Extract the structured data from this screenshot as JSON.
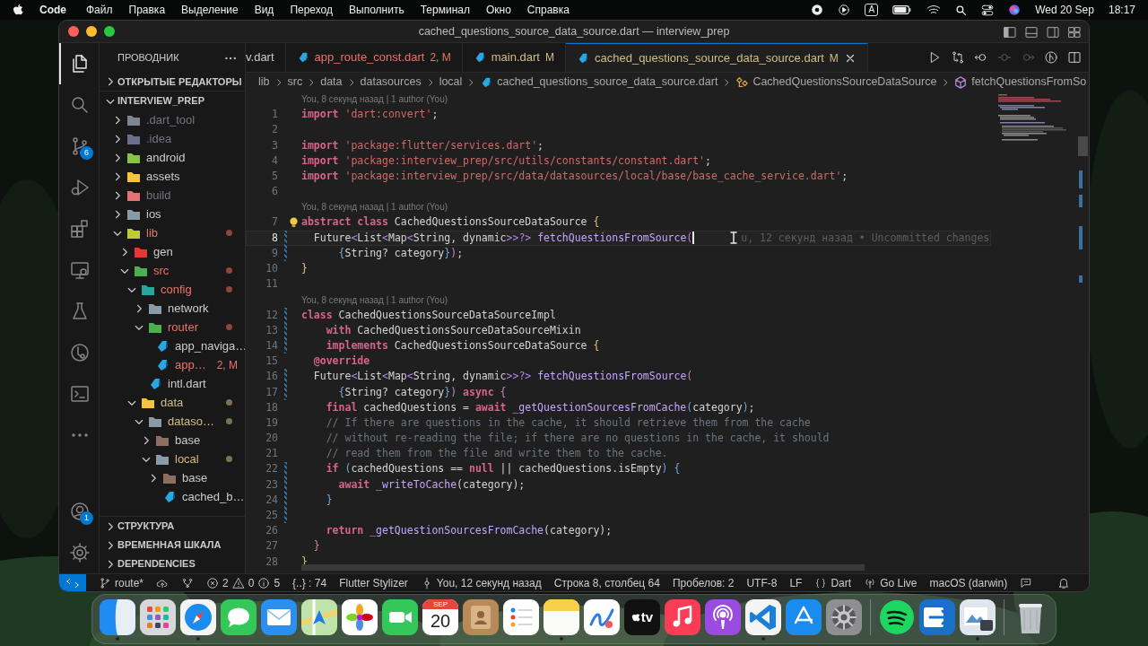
{
  "menu_bar": {
    "app": "Code",
    "items": [
      "Файл",
      "Правка",
      "Выделение",
      "Вид",
      "Переход",
      "Выполнить",
      "Терминал",
      "Окно",
      "Справка"
    ],
    "input_source": "A",
    "date": "Wed 20 Sep",
    "time": "18:17"
  },
  "window": {
    "title": "cached_questions_source_data_source.dart — interview_prep"
  },
  "activity_bar": {
    "top": [
      {
        "kind": "files",
        "selected": true
      },
      {
        "kind": "search",
        "selected": false
      },
      {
        "kind": "scm",
        "selected": false,
        "badge": "6"
      },
      {
        "kind": "debug",
        "selected": false
      },
      {
        "kind": "extensions",
        "selected": false
      },
      {
        "kind": "remote",
        "selected": false
      },
      {
        "kind": "testing",
        "selected": false
      },
      {
        "kind": "timeline",
        "selected": false
      },
      {
        "kind": "terminal",
        "selected": false
      },
      {
        "kind": "more",
        "selected": false
      }
    ],
    "bottom": [
      {
        "kind": "account",
        "selected": false,
        "badge": "1"
      },
      {
        "kind": "settings",
        "selected": false
      }
    ]
  },
  "sidebar": {
    "title": "ПРОВОДНИК",
    "open_editors": {
      "label": "ОТКРЫТЫЕ РЕДАКТОРЫ",
      "expanded": false
    },
    "project": {
      "label": "INTERVIEW_PREP",
      "expanded": true
    },
    "tree": [
      {
        "label": ".dart_tool",
        "kind": "folder",
        "expanded": false,
        "color": "#6e7681",
        "icon": {
          "color": "#7d8590"
        },
        "dot": false
      },
      {
        "label": ".idea",
        "kind": "folder",
        "expanded": false,
        "color": "#6e7681",
        "icon": {
          "color": "#6d6f8a"
        },
        "dot": false
      },
      {
        "label": "android",
        "kind": "folder",
        "expanded": false,
        "color": "#cccccc",
        "icon": {
          "color": "#8bc34a"
        },
        "dot": false
      },
      {
        "label": "assets",
        "kind": "folder",
        "expanded": false,
        "color": "#cccccc",
        "icon": {
          "color": "#f5c242"
        },
        "dot": false
      },
      {
        "label": "build",
        "kind": "folder",
        "expanded": false,
        "color": "#6e7681",
        "icon": {
          "color": "#e57373"
        },
        "dot": false
      },
      {
        "label": "ios",
        "kind": "folder",
        "expanded": false,
        "color": "#cccccc",
        "icon": {
          "color": "#8a9aa6"
        },
        "dot": false
      },
      {
        "label": "lib",
        "kind": "folder",
        "expanded": true,
        "color": "#e8746b",
        "icon": {
          "color": "#c0ca33"
        },
        "dot": true,
        "children": [
          {
            "label": "gen",
            "kind": "folder",
            "expanded": false,
            "color": "#cccccc",
            "icon": {
              "color": "#e53935"
            },
            "dot": false
          },
          {
            "label": "src",
            "kind": "folder",
            "expanded": true,
            "color": "#e8746b",
            "icon": {
              "color": "#4caf50"
            },
            "dot": true,
            "children": [
              {
                "label": "config",
                "kind": "folder",
                "expanded": true,
                "color": "#e8746b",
                "icon": {
                  "color": "#26a69a"
                },
                "dot": true,
                "children": [
                  {
                    "label": "network",
                    "kind": "folder",
                    "expanded": false,
                    "color": "#cccccc",
                    "icon": {
                      "color": "#8a9aa6"
                    },
                    "dot": false
                  },
                  {
                    "label": "router",
                    "kind": "folder",
                    "expanded": true,
                    "color": "#e8746b",
                    "icon": {
                      "color": "#4caf50"
                    },
                    "dot": true,
                    "children": [
                      {
                        "label": "app_naviga…",
                        "kind": "file",
                        "color": "#cccccc",
                        "dot": false
                      },
                      {
                        "label": "app…",
                        "kind": "file",
                        "color": "#e8746b",
                        "badge": "2, M",
                        "dot": false
                      }
                    ]
                  },
                  {
                    "label": "intl.dart",
                    "kind": "file",
                    "color": "#cccccc",
                    "dot": false
                  }
                ]
              },
              {
                "label": "data",
                "kind": "folder",
                "expanded": true,
                "color": "#d2bd84",
                "icon": {
                  "color": "#f5c242"
                },
                "dot": true,
                "children": [
                  {
                    "label": "dataso…",
                    "kind": "folder",
                    "expanded": true,
                    "color": "#d2bd84",
                    "icon": {
                      "color": "#8a9aa6"
                    },
                    "dot": true,
                    "children": [
                      {
                        "label": "base",
                        "kind": "folder",
                        "expanded": false,
                        "color": "#cccccc",
                        "icon": {
                          "color": "#8d6e63"
                        },
                        "dot": false
                      },
                      {
                        "label": "local",
                        "kind": "folder",
                        "expanded": true,
                        "color": "#d2bd84",
                        "icon": {
                          "color": "#8a9aa6"
                        },
                        "dot": true,
                        "children": [
                          {
                            "label": "base",
                            "kind": "folder",
                            "expanded": false,
                            "color": "#cccccc",
                            "icon": {
                              "color": "#8d6e63"
                            },
                            "dot": false
                          },
                          {
                            "label": "cached_b…",
                            "kind": "file",
                            "color": "#cccccc",
                            "dot": false
                          }
                        ]
                      }
                    ]
                  }
                ]
              }
            ]
          }
        ]
      }
    ],
    "bottom_sections": [
      {
        "label": "СТРУКТУРА",
        "expanded": false
      },
      {
        "label": "ВРЕМЕННАЯ ШКАЛА",
        "expanded": false
      },
      {
        "label": "DEPENDENCIES",
        "expanded": false
      }
    ]
  },
  "tabs": [
    {
      "label": "v.dart",
      "color": "#cccccc",
      "icon": false,
      "selected": false
    },
    {
      "label": "app_route_const.dart",
      "badge": "2, M",
      "color": "#e8746b",
      "icon": true,
      "selected": false
    },
    {
      "label": "main.dart",
      "badge": "M",
      "color": "#d2bd84",
      "icon": true,
      "selected": false
    },
    {
      "label": "cached_questions_source_data_source.dart",
      "badge": "M",
      "color": "#d2bd84",
      "icon": true,
      "selected": true
    }
  ],
  "editor_actions": [
    {
      "kind": "run",
      "disabled": false
    },
    {
      "kind": "compare",
      "disabled": false
    },
    {
      "kind": "back",
      "disabled": false
    },
    {
      "kind": "dot",
      "disabled": true
    },
    {
      "kind": "forward",
      "disabled": true
    },
    {
      "kind": "graph",
      "disabled": false
    },
    {
      "kind": "split",
      "disabled": false
    }
  ],
  "breadcrumbs": [
    {
      "label": "lib",
      "kind": "folder"
    },
    {
      "label": "src",
      "kind": "folder"
    },
    {
      "label": "data",
      "kind": "folder"
    },
    {
      "label": "datasources",
      "kind": "folder"
    },
    {
      "label": "local",
      "kind": "folder"
    },
    {
      "label": "cached_questions_source_data_source.dart",
      "kind": "file"
    },
    {
      "label": "CachedQuestionsSourceDataSource",
      "kind": "class"
    },
    {
      "label": "fetchQuestionsFromSo",
      "kind": "method"
    }
  ],
  "editor": {
    "lines": [
      {
        "kind": "blame",
        "text": "You, 8 секунд назад | 1 author (You)"
      },
      {
        "kind": "code",
        "number": "1",
        "modified": false,
        "current": false,
        "tokens": [
          {
            "kind": "kw",
            "text": "import"
          },
          {
            "kind": "str",
            "text": " 'dart:convert'"
          },
          {
            "kind": "tx",
            "text": ";"
          }
        ]
      },
      {
        "kind": "code",
        "number": "2",
        "modified": false,
        "current": false
      },
      {
        "kind": "code",
        "number": "3",
        "modified": false,
        "current": false,
        "tokens": [
          {
            "kind": "kw",
            "text": "import"
          },
          {
            "kind": "str",
            "text": " 'package:flutter/services.dart'"
          },
          {
            "kind": "tx",
            "text": ";"
          }
        ]
      },
      {
        "kind": "code",
        "number": "4",
        "modified": false,
        "current": false,
        "tokens": [
          {
            "kind": "kw",
            "text": "import"
          },
          {
            "kind": "str",
            "text": " 'package:interview_prep/src/utils/constants/constant.dart'"
          },
          {
            "kind": "tx",
            "text": ";"
          }
        ]
      },
      {
        "kind": "code",
        "number": "5",
        "modified": false,
        "current": false,
        "tokens": [
          {
            "kind": "kw",
            "text": "import"
          },
          {
            "kind": "str",
            "text": " 'package:interview_prep/src/data/datasources/local/base/base_cache_service.dart'"
          },
          {
            "kind": "tx",
            "text": ";"
          }
        ]
      },
      {
        "kind": "code",
        "number": "6",
        "modified": false,
        "current": false
      },
      {
        "kind": "blame",
        "text": "You, 8 секунд назад | 1 author (You)"
      },
      {
        "kind": "code",
        "number": "7",
        "modified": false,
        "current": false,
        "bulb": true,
        "tokens": [
          {
            "kind": "kw",
            "text": "abstract class"
          },
          {
            "kind": "tx",
            "text": " CachedQuestionsSourceDataSource "
          },
          {
            "kind": "p1",
            "text": "{"
          }
        ]
      },
      {
        "kind": "code",
        "number": "8",
        "modified": true,
        "current": true,
        "ghost": "u, 12 секунд назад • Uncommitted changes",
        "tokens": [
          {
            "kind": "tx",
            "text": "  Future"
          },
          {
            "kind": "gen",
            "text": "<"
          },
          {
            "kind": "tx",
            "text": "List"
          },
          {
            "kind": "gen",
            "text": "<"
          },
          {
            "kind": "tx",
            "text": "Map"
          },
          {
            "kind": "gen",
            "text": "<"
          },
          {
            "kind": "tx",
            "text": "String, dynamic"
          },
          {
            "kind": "gen",
            "text": ">>?>"
          },
          {
            "kind": "fn",
            "text": " fetchQuestionsFromSource"
          },
          {
            "kind": "p2",
            "text": "("
          }
        ]
      },
      {
        "kind": "code",
        "number": "9",
        "modified": true,
        "current": false,
        "tokens": [
          {
            "kind": "p3",
            "text": "      {"
          },
          {
            "kind": "tx",
            "text": "String? category"
          },
          {
            "kind": "p3",
            "text": "}"
          },
          {
            "kind": "p2",
            "text": ")"
          },
          {
            "kind": "tx",
            "text": ";"
          }
        ]
      },
      {
        "kind": "code",
        "number": "10",
        "modified": false,
        "current": false,
        "tokens": [
          {
            "kind": "p1",
            "text": "}"
          }
        ]
      },
      {
        "kind": "code",
        "number": "11",
        "modified": false,
        "current": false
      },
      {
        "kind": "blame",
        "text": "You, 8 секунд назад | 1 author (You)"
      },
      {
        "kind": "code",
        "number": "12",
        "modified": true,
        "current": false,
        "tokens": [
          {
            "kind": "kw",
            "text": "class"
          },
          {
            "kind": "tx",
            "text": " CachedQuestionsSourceDataSourceImpl"
          }
        ]
      },
      {
        "kind": "code",
        "number": "13",
        "modified": true,
        "current": false,
        "tokens": [
          {
            "kind": "kw",
            "text": "    with"
          },
          {
            "kind": "tx",
            "text": " CachedQuestionsSourceDataSourceMixin"
          }
        ]
      },
      {
        "kind": "code",
        "number": "14",
        "modified": true,
        "current": false,
        "tokens": [
          {
            "kind": "kw",
            "text": "    implements"
          },
          {
            "kind": "tx",
            "text": " CachedQuestionsSourceDataSource "
          },
          {
            "kind": "p1",
            "text": "{"
          }
        ]
      },
      {
        "kind": "code",
        "number": "15",
        "modified": false,
        "current": false,
        "tokens": [
          {
            "kind": "kw",
            "text": "  @override"
          }
        ]
      },
      {
        "kind": "code",
        "number": "16",
        "modified": true,
        "current": false,
        "tokens": [
          {
            "kind": "tx",
            "text": "  Future"
          },
          {
            "kind": "gen",
            "text": "<"
          },
          {
            "kind": "tx",
            "text": "List"
          },
          {
            "kind": "gen",
            "text": "<"
          },
          {
            "kind": "tx",
            "text": "Map"
          },
          {
            "kind": "gen",
            "text": "<"
          },
          {
            "kind": "tx",
            "text": "String, dynamic"
          },
          {
            "kind": "gen",
            "text": ">>?>"
          },
          {
            "kind": "fn",
            "text": " fetchQuestionsFromSource"
          },
          {
            "kind": "p2",
            "text": "("
          }
        ]
      },
      {
        "kind": "code",
        "number": "17",
        "modified": true,
        "current": false,
        "tokens": [
          {
            "kind": "p3",
            "text": "      {"
          },
          {
            "kind": "tx",
            "text": "String? category"
          },
          {
            "kind": "p3",
            "text": "}"
          },
          {
            "kind": "p2",
            "text": ")"
          },
          {
            "kind": "kw",
            "text": " async"
          },
          {
            "kind": "p2",
            "text": " {"
          }
        ]
      },
      {
        "kind": "code",
        "number": "18",
        "modified": false,
        "current": false,
        "tokens": [
          {
            "kind": "kw",
            "text": "    final"
          },
          {
            "kind": "tx",
            "text": " cachedQuestions = "
          },
          {
            "kind": "kw",
            "text": "await"
          },
          {
            "kind": "fn",
            "text": " _getQuestionSourcesFromCache"
          },
          {
            "kind": "p3",
            "text": "("
          },
          {
            "kind": "tx",
            "text": "category"
          },
          {
            "kind": "p3",
            "text": ")"
          },
          {
            "kind": "tx",
            "text": ";"
          }
        ]
      },
      {
        "kind": "code",
        "number": "19",
        "modified": false,
        "current": false,
        "tokens": [
          {
            "kind": "cm",
            "text": "    // If there are questions in the cache, it should retrieve them from the cache"
          }
        ]
      },
      {
        "kind": "code",
        "number": "20",
        "modified": false,
        "current": false,
        "tokens": [
          {
            "kind": "cm",
            "text": "    // without re-reading the file; if there are no questions in the cache, it should"
          }
        ]
      },
      {
        "kind": "code",
        "number": "21",
        "modified": false,
        "current": false,
        "tokens": [
          {
            "kind": "cm",
            "text": "    // read them from the file and write them to the cache."
          }
        ]
      },
      {
        "kind": "code",
        "number": "22",
        "modified": true,
        "current": false,
        "tokens": [
          {
            "kind": "kw",
            "text": "    if"
          },
          {
            "kind": "p3",
            "text": " ("
          },
          {
            "kind": "tx",
            "text": "cachedQuestions == "
          },
          {
            "kind": "kw",
            "text": "null"
          },
          {
            "kind": "tx",
            "text": " || cachedQuestions.isEmpty"
          },
          {
            "kind": "p3",
            "text": ")"
          },
          {
            "kind": "p3",
            "text": " {"
          }
        ]
      },
      {
        "kind": "code",
        "number": "23",
        "modified": true,
        "current": false,
        "tokens": [
          {
            "kind": "kw",
            "text": "      await"
          },
          {
            "kind": "fn",
            "text": " _writeToCache"
          },
          {
            "kind": "tx",
            "text": "(category);"
          }
        ]
      },
      {
        "kind": "code",
        "number": "24",
        "modified": true,
        "current": false,
        "tokens": [
          {
            "kind": "p3",
            "text": "    }"
          }
        ]
      },
      {
        "kind": "code",
        "number": "25",
        "modified": true,
        "current": false
      },
      {
        "kind": "code",
        "number": "26",
        "modified": false,
        "current": false,
        "tokens": [
          {
            "kind": "kw",
            "text": "    return"
          },
          {
            "kind": "fn",
            "text": " _getQuestionSourcesFromCache"
          },
          {
            "kind": "tx",
            "text": "(category);"
          }
        ]
      },
      {
        "kind": "code",
        "number": "27",
        "modified": false,
        "current": false,
        "tokens": [
          {
            "kind": "p2",
            "text": "  }"
          }
        ]
      },
      {
        "kind": "code",
        "number": "28",
        "modified": false,
        "current": false,
        "tokens": [
          {
            "kind": "p1",
            "text": "}"
          }
        ]
      }
    ]
  },
  "status_bar": [
    {
      "kind": "remote"
    },
    {
      "kind": "branch",
      "text": "route*"
    },
    {
      "kind": "sync"
    },
    {
      "kind": "graph"
    },
    {
      "kind": "error",
      "text": "2"
    },
    {
      "kind": "warning",
      "text": "0"
    },
    {
      "kind": "info",
      "text": "5"
    },
    {
      "kind": "plain",
      "text": "{..} : 74"
    },
    {
      "kind": "plain",
      "text": "Flutter Stylizer"
    },
    {
      "kind": "commit",
      "text": "You, 12 секунд назад"
    },
    {
      "kind": "plain",
      "text": "Строка 8, столбец 64"
    },
    {
      "kind": "plain",
      "text": "Пробелов: 2"
    },
    {
      "kind": "plain",
      "text": "UTF-8"
    },
    {
      "kind": "plain",
      "text": "LF"
    },
    {
      "kind": "braces",
      "text": "Dart"
    },
    {
      "kind": "broadcast",
      "text": "Go Live"
    },
    {
      "kind": "plain",
      "text": "macOS (darwin)"
    },
    {
      "kind": "feedback"
    },
    {
      "kind": "bell"
    }
  ],
  "dock": [
    {
      "kind": "finder",
      "running": true
    },
    {
      "kind": "launchpad",
      "running": false
    },
    {
      "kind": "safari",
      "running": true
    },
    {
      "kind": "messages",
      "running": false
    },
    {
      "kind": "mail",
      "running": false
    },
    {
      "kind": "maps",
      "running": false
    },
    {
      "kind": "photos",
      "running": false
    },
    {
      "kind": "facetime",
      "running": false
    },
    {
      "kind": "calendar",
      "month": "SEP",
      "day": "20",
      "running": false
    },
    {
      "kind": "contacts",
      "running": false
    },
    {
      "kind": "reminders",
      "running": false
    },
    {
      "kind": "notes",
      "running": true
    },
    {
      "kind": "freeform",
      "running": false
    },
    {
      "kind": "tv",
      "label": "tv",
      "running": false
    },
    {
      "kind": "music",
      "running": false
    },
    {
      "kind": "podcasts",
      "running": false
    },
    {
      "kind": "vscode",
      "running": true
    },
    {
      "kind": "appstore",
      "running": false
    },
    {
      "kind": "settings",
      "running": false
    },
    {
      "kind": "separator"
    },
    {
      "kind": "spotify",
      "running": false
    },
    {
      "kind": "arrow",
      "running": false
    },
    {
      "kind": "preview",
      "running": true
    },
    {
      "kind": "separator"
    },
    {
      "kind": "trash",
      "running": false
    }
  ]
}
